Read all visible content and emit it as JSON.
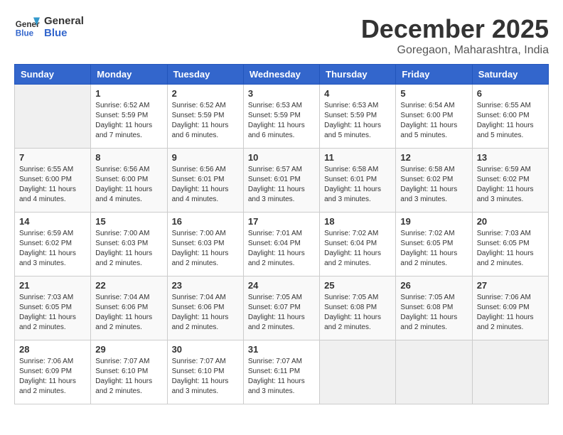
{
  "header": {
    "logo_line1": "General",
    "logo_line2": "Blue",
    "month_title": "December 2025",
    "location": "Goregaon, Maharashtra, India"
  },
  "days_of_week": [
    "Sunday",
    "Monday",
    "Tuesday",
    "Wednesday",
    "Thursday",
    "Friday",
    "Saturday"
  ],
  "weeks": [
    [
      {
        "day": "",
        "empty": true
      },
      {
        "day": "1",
        "sunrise": "Sunrise: 6:52 AM",
        "sunset": "Sunset: 5:59 PM",
        "daylight": "Daylight: 11 hours and 7 minutes."
      },
      {
        "day": "2",
        "sunrise": "Sunrise: 6:52 AM",
        "sunset": "Sunset: 5:59 PM",
        "daylight": "Daylight: 11 hours and 6 minutes."
      },
      {
        "day": "3",
        "sunrise": "Sunrise: 6:53 AM",
        "sunset": "Sunset: 5:59 PM",
        "daylight": "Daylight: 11 hours and 6 minutes."
      },
      {
        "day": "4",
        "sunrise": "Sunrise: 6:53 AM",
        "sunset": "Sunset: 5:59 PM",
        "daylight": "Daylight: 11 hours and 5 minutes."
      },
      {
        "day": "5",
        "sunrise": "Sunrise: 6:54 AM",
        "sunset": "Sunset: 6:00 PM",
        "daylight": "Daylight: 11 hours and 5 minutes."
      },
      {
        "day": "6",
        "sunrise": "Sunrise: 6:55 AM",
        "sunset": "Sunset: 6:00 PM",
        "daylight": "Daylight: 11 hours and 5 minutes."
      }
    ],
    [
      {
        "day": "7",
        "sunrise": "Sunrise: 6:55 AM",
        "sunset": "Sunset: 6:00 PM",
        "daylight": "Daylight: 11 hours and 4 minutes."
      },
      {
        "day": "8",
        "sunrise": "Sunrise: 6:56 AM",
        "sunset": "Sunset: 6:00 PM",
        "daylight": "Daylight: 11 hours and 4 minutes."
      },
      {
        "day": "9",
        "sunrise": "Sunrise: 6:56 AM",
        "sunset": "Sunset: 6:01 PM",
        "daylight": "Daylight: 11 hours and 4 minutes."
      },
      {
        "day": "10",
        "sunrise": "Sunrise: 6:57 AM",
        "sunset": "Sunset: 6:01 PM",
        "daylight": "Daylight: 11 hours and 3 minutes."
      },
      {
        "day": "11",
        "sunrise": "Sunrise: 6:58 AM",
        "sunset": "Sunset: 6:01 PM",
        "daylight": "Daylight: 11 hours and 3 minutes."
      },
      {
        "day": "12",
        "sunrise": "Sunrise: 6:58 AM",
        "sunset": "Sunset: 6:02 PM",
        "daylight": "Daylight: 11 hours and 3 minutes."
      },
      {
        "day": "13",
        "sunrise": "Sunrise: 6:59 AM",
        "sunset": "Sunset: 6:02 PM",
        "daylight": "Daylight: 11 hours and 3 minutes."
      }
    ],
    [
      {
        "day": "14",
        "sunrise": "Sunrise: 6:59 AM",
        "sunset": "Sunset: 6:02 PM",
        "daylight": "Daylight: 11 hours and 3 minutes."
      },
      {
        "day": "15",
        "sunrise": "Sunrise: 7:00 AM",
        "sunset": "Sunset: 6:03 PM",
        "daylight": "Daylight: 11 hours and 2 minutes."
      },
      {
        "day": "16",
        "sunrise": "Sunrise: 7:00 AM",
        "sunset": "Sunset: 6:03 PM",
        "daylight": "Daylight: 11 hours and 2 minutes."
      },
      {
        "day": "17",
        "sunrise": "Sunrise: 7:01 AM",
        "sunset": "Sunset: 6:04 PM",
        "daylight": "Daylight: 11 hours and 2 minutes."
      },
      {
        "day": "18",
        "sunrise": "Sunrise: 7:02 AM",
        "sunset": "Sunset: 6:04 PM",
        "daylight": "Daylight: 11 hours and 2 minutes."
      },
      {
        "day": "19",
        "sunrise": "Sunrise: 7:02 AM",
        "sunset": "Sunset: 6:05 PM",
        "daylight": "Daylight: 11 hours and 2 minutes."
      },
      {
        "day": "20",
        "sunrise": "Sunrise: 7:03 AM",
        "sunset": "Sunset: 6:05 PM",
        "daylight": "Daylight: 11 hours and 2 minutes."
      }
    ],
    [
      {
        "day": "21",
        "sunrise": "Sunrise: 7:03 AM",
        "sunset": "Sunset: 6:05 PM",
        "daylight": "Daylight: 11 hours and 2 minutes."
      },
      {
        "day": "22",
        "sunrise": "Sunrise: 7:04 AM",
        "sunset": "Sunset: 6:06 PM",
        "daylight": "Daylight: 11 hours and 2 minutes."
      },
      {
        "day": "23",
        "sunrise": "Sunrise: 7:04 AM",
        "sunset": "Sunset: 6:06 PM",
        "daylight": "Daylight: 11 hours and 2 minutes."
      },
      {
        "day": "24",
        "sunrise": "Sunrise: 7:05 AM",
        "sunset": "Sunset: 6:07 PM",
        "daylight": "Daylight: 11 hours and 2 minutes."
      },
      {
        "day": "25",
        "sunrise": "Sunrise: 7:05 AM",
        "sunset": "Sunset: 6:08 PM",
        "daylight": "Daylight: 11 hours and 2 minutes."
      },
      {
        "day": "26",
        "sunrise": "Sunrise: 7:05 AM",
        "sunset": "Sunset: 6:08 PM",
        "daylight": "Daylight: 11 hours and 2 minutes."
      },
      {
        "day": "27",
        "sunrise": "Sunrise: 7:06 AM",
        "sunset": "Sunset: 6:09 PM",
        "daylight": "Daylight: 11 hours and 2 minutes."
      }
    ],
    [
      {
        "day": "28",
        "sunrise": "Sunrise: 7:06 AM",
        "sunset": "Sunset: 6:09 PM",
        "daylight": "Daylight: 11 hours and 2 minutes."
      },
      {
        "day": "29",
        "sunrise": "Sunrise: 7:07 AM",
        "sunset": "Sunset: 6:10 PM",
        "daylight": "Daylight: 11 hours and 2 minutes."
      },
      {
        "day": "30",
        "sunrise": "Sunrise: 7:07 AM",
        "sunset": "Sunset: 6:10 PM",
        "daylight": "Daylight: 11 hours and 3 minutes."
      },
      {
        "day": "31",
        "sunrise": "Sunrise: 7:07 AM",
        "sunset": "Sunset: 6:11 PM",
        "daylight": "Daylight: 11 hours and 3 minutes."
      },
      {
        "day": "",
        "empty": true
      },
      {
        "day": "",
        "empty": true
      },
      {
        "day": "",
        "empty": true
      }
    ]
  ]
}
